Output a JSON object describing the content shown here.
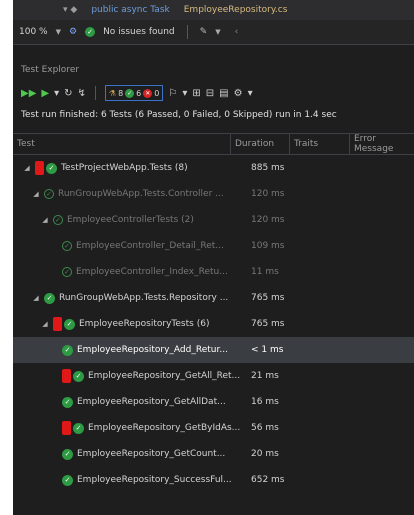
{
  "toolbar_top": {
    "zoom": "100 %",
    "issues": "No issues found",
    "file_name": "EmployeeRepository.cs"
  },
  "test_explorer": {
    "title": "Test Explorer",
    "counts": {
      "total": "8",
      "passed": "6",
      "failed": "0"
    },
    "summary": "Test run finished: 6 Tests (6 Passed, 0 Failed, 0 Skipped) run in 1.4 sec",
    "columns": {
      "test": "Test",
      "duration": "Duration",
      "traits": "Traits",
      "error": "Error Message"
    },
    "rows": [
      {
        "name": "TestProjectWebApp.Tests (8)",
        "duration": "885 ms",
        "status": "fail-mark",
        "indent": 0,
        "expander": "◢",
        "dim": false
      },
      {
        "name": "RunGroupWebApp.Tests.Controller ...",
        "duration": "120 ms",
        "status": "outline",
        "indent": 1,
        "expander": "◢",
        "dim": true
      },
      {
        "name": "EmployeeControllerTests (2)",
        "duration": "120 ms",
        "status": "outline",
        "indent": 2,
        "expander": "◢",
        "dim": true
      },
      {
        "name": "EmployeeController_Detail_Ret...",
        "duration": "109 ms",
        "status": "outline",
        "indent": 3,
        "expander": "",
        "dim": true
      },
      {
        "name": "EmployeeController_Index_Retu...",
        "duration": "11 ms",
        "status": "outline",
        "indent": 3,
        "expander": "",
        "dim": true
      },
      {
        "name": "RunGroupWebApp.Tests.Repository ...",
        "duration": "765 ms",
        "status": "pass",
        "indent": 1,
        "expander": "◢",
        "dim": false
      },
      {
        "name": "EmployeeRepositoryTests (6)",
        "duration": "765 ms",
        "status": "fail-mark",
        "indent": 2,
        "expander": "◢",
        "dim": false
      },
      {
        "name": "EmployeeRepository_Add_Retur...",
        "duration": "< 1 ms",
        "status": "pass",
        "indent": 3,
        "expander": "",
        "dim": false,
        "selected": true
      },
      {
        "name": "EmployeeRepository_GetAll_Ret...",
        "duration": "21 ms",
        "status": "fail-mark",
        "indent": 3,
        "expander": "",
        "dim": false
      },
      {
        "name": "EmployeeRepository_GetAllDat...",
        "duration": "16 ms",
        "status": "pass",
        "indent": 3,
        "expander": "",
        "dim": false
      },
      {
        "name": "EmployeeRepository_GetByIdAs...",
        "duration": "56 ms",
        "status": "fail-mark",
        "indent": 3,
        "expander": "",
        "dim": false
      },
      {
        "name": "EmployeeRepository_GetCount...",
        "duration": "20 ms",
        "status": "pass",
        "indent": 3,
        "expander": "",
        "dim": false
      },
      {
        "name": "EmployeeRepository_SuccessFul...",
        "duration": "652 ms",
        "status": "pass",
        "indent": 3,
        "expander": "",
        "dim": false
      }
    ]
  }
}
